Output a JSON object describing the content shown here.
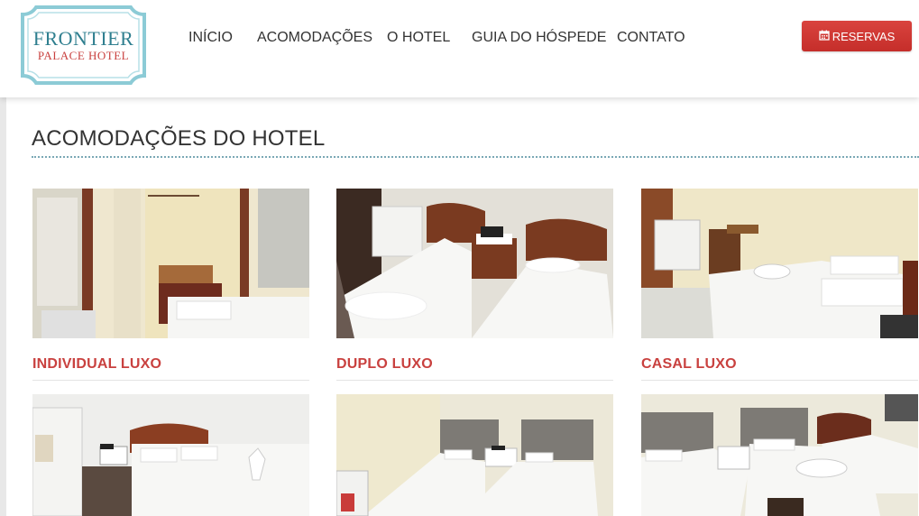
{
  "logo": {
    "line1": "FRONTIER",
    "line2": "PALACE HOTEL"
  },
  "nav": {
    "items": [
      {
        "label": "INÍCIO"
      },
      {
        "label": "ACOMODAÇÕES"
      },
      {
        "label": "O HOTEL"
      },
      {
        "label": "GUIA DO HÓSPEDE"
      },
      {
        "label": "CONTATO"
      }
    ],
    "reserve_label": "RESERVAS",
    "reserve_icon": "calendar-icon"
  },
  "page": {
    "title": "ACOMODAÇÕES DO HOTEL",
    "rooms": [
      {
        "name": "INDIVIDUAL LUXO"
      },
      {
        "name": "DUPLO LUXO"
      },
      {
        "name": "CASAL LUXO"
      },
      {
        "name": ""
      },
      {
        "name": ""
      },
      {
        "name": ""
      }
    ]
  },
  "colors": {
    "accent": "#c9413f",
    "logo_teal": "#2f7f8f",
    "button_red": "#d9433e"
  }
}
